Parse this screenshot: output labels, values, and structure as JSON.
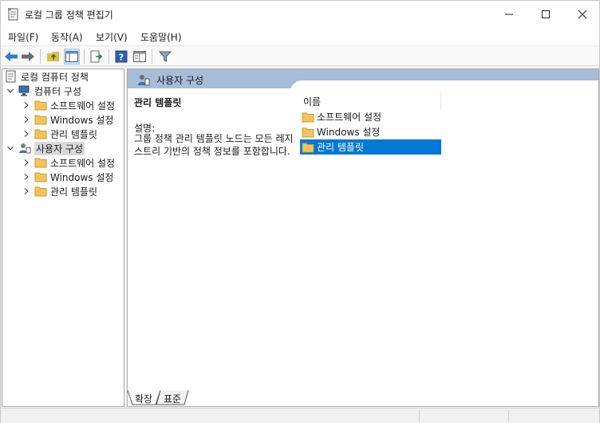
{
  "window": {
    "title": "로컬 그룹 정책 편집기"
  },
  "menu": [
    {
      "label": "파일(F)"
    },
    {
      "label": "동작(A)"
    },
    {
      "label": "보기(V)"
    },
    {
      "label": "도움말(H)"
    }
  ],
  "toolbar": {
    "icons": [
      "back-arrow-icon",
      "forward-arrow-icon",
      "up-folder-icon",
      "show-hide-tree-icon",
      "export-list-icon",
      "help-icon",
      "properties-view-icon",
      "filter-icon"
    ]
  },
  "tree": {
    "root": "로컬 컴퓨터 정책",
    "computer": {
      "label": "컴퓨터 구성",
      "children": [
        "소프트웨어 설정",
        "Windows 설정",
        "관리 템플릿"
      ]
    },
    "user": {
      "label": "사용자 구성",
      "children": [
        "소프트웨어 설정",
        "Windows 설정",
        "관리 템플릿"
      ]
    }
  },
  "main": {
    "header": "사용자 구성",
    "desc_title": "관리 템플릿",
    "desc_label": "설명:",
    "desc_text": "그룹 정책 관리 템플릿 노드는 모든 레지스트리 기반의 정책 정보를 포함합니다.",
    "column_name": "이름",
    "items": [
      {
        "label": "소프트웨어 설정"
      },
      {
        "label": "Windows 설정"
      },
      {
        "label": "관리 템플릿"
      }
    ]
  },
  "tabs": {
    "extended": "확장",
    "standard": "표준"
  },
  "colors": {
    "selection": "#0078d7",
    "header_band": "#a7bcd6",
    "folder": "#f2c55c"
  }
}
